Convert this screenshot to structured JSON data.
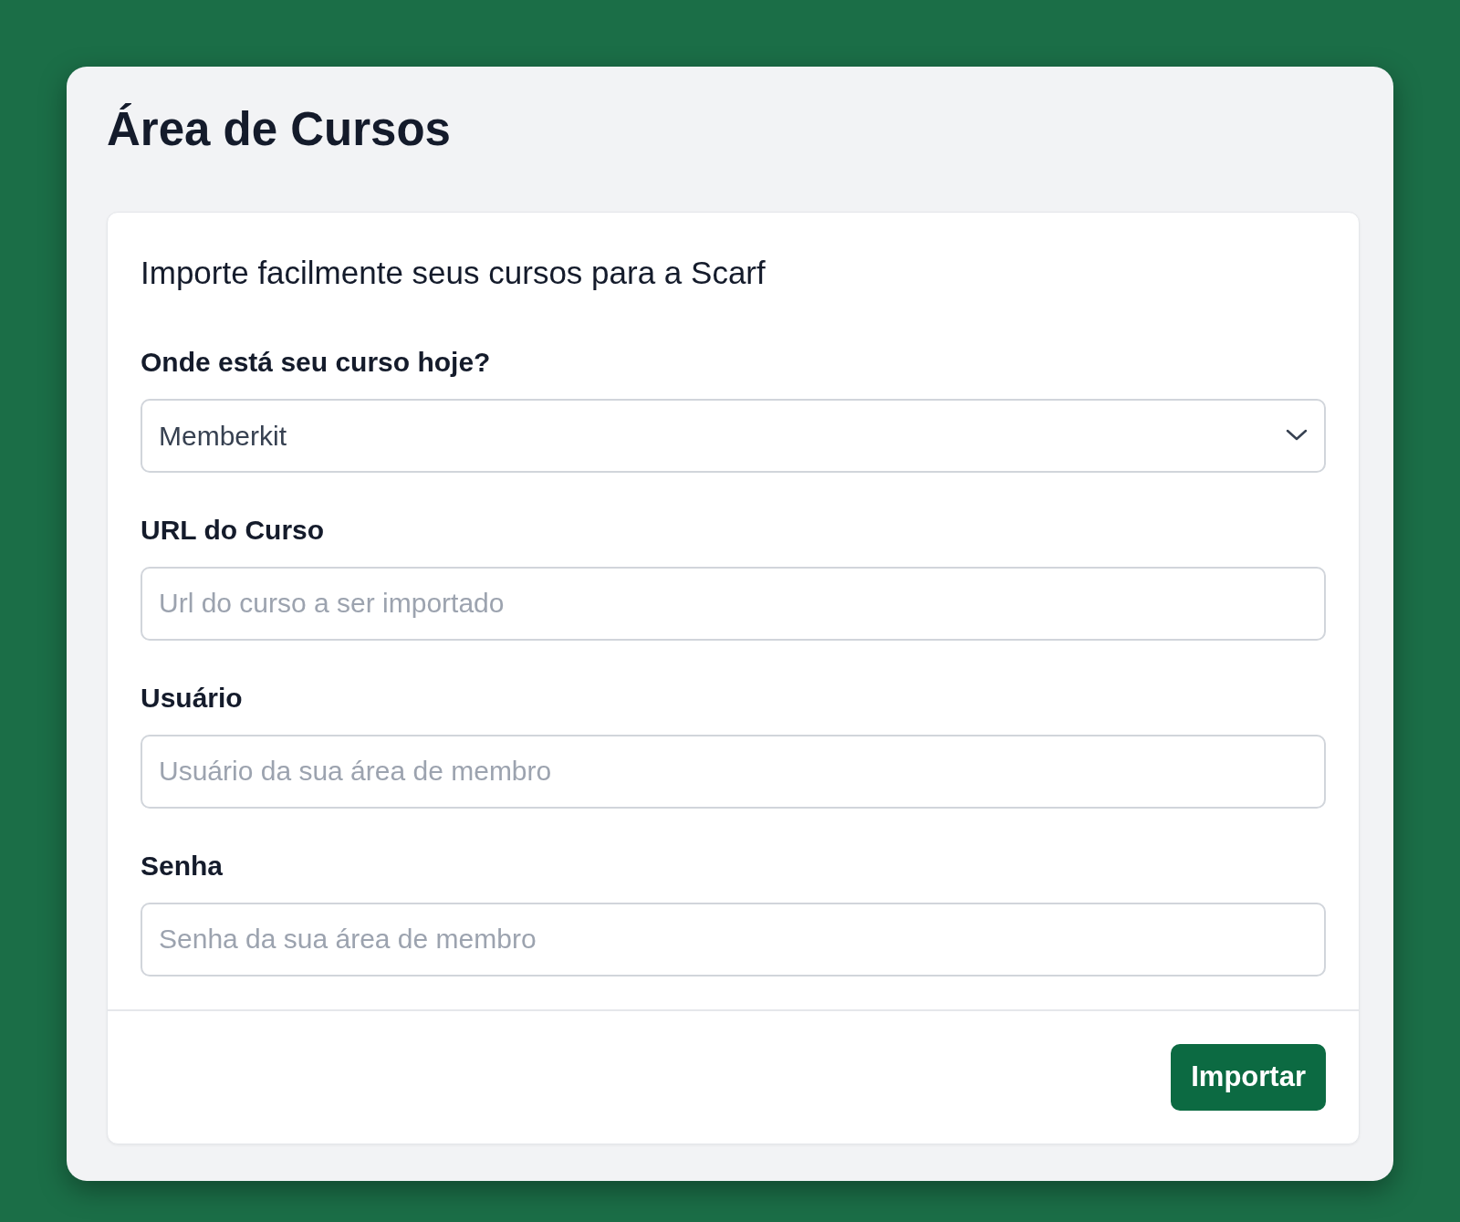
{
  "title": "Área de Cursos",
  "intro": "Importe facilmente seus cursos para a Scarf",
  "fields": [
    {
      "kind": "select",
      "label": "Onde está seu curso hoje?",
      "value": "Memberkit"
    },
    {
      "kind": "text",
      "label": "URL do Curso",
      "placeholder": "Url do curso a ser importado"
    },
    {
      "kind": "text",
      "label": "Usuário",
      "placeholder": "Usuário da sua área de membro"
    },
    {
      "kind": "password",
      "label": "Senha",
      "placeholder": "Senha da sua área de membro"
    }
  ],
  "button": "Importar"
}
